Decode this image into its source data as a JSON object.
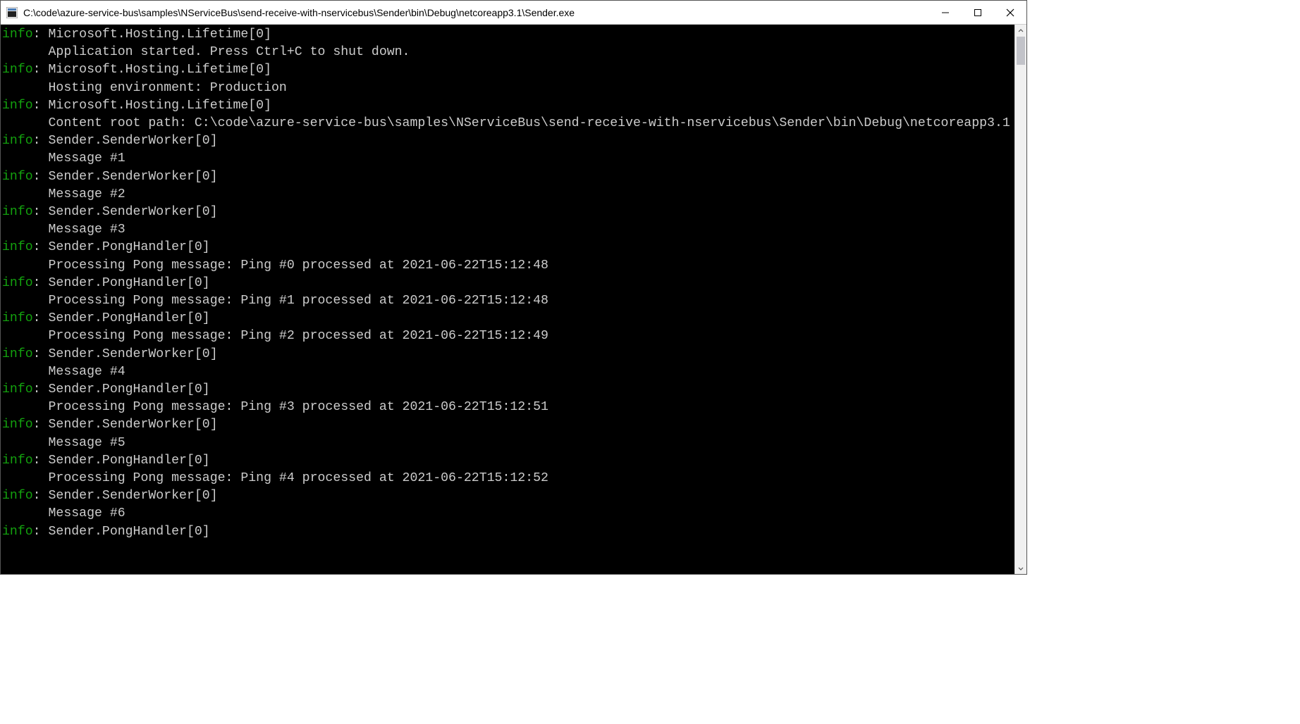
{
  "window": {
    "title": "C:\\code\\azure-service-bus\\samples\\NServiceBus\\send-receive-with-nservicebus\\Sender\\bin\\Debug\\netcoreapp3.1\\Sender.exe"
  },
  "log": {
    "level_label": "info",
    "indent": "      ",
    "entries": [
      {
        "source": "Microsoft.Hosting.Lifetime[0]",
        "body": "Application started. Press Ctrl+C to shut down."
      },
      {
        "source": "Microsoft.Hosting.Lifetime[0]",
        "body": "Hosting environment: Production"
      },
      {
        "source": "Microsoft.Hosting.Lifetime[0]",
        "body": "Content root path: C:\\code\\azure-service-bus\\samples\\NServiceBus\\send-receive-with-nservicebus\\Sender\\bin\\Debug\\netcoreapp3.1"
      },
      {
        "source": "Sender.SenderWorker[0]",
        "body": "Message #1"
      },
      {
        "source": "Sender.SenderWorker[0]",
        "body": "Message #2"
      },
      {
        "source": "Sender.SenderWorker[0]",
        "body": "Message #3"
      },
      {
        "source": "Sender.PongHandler[0]",
        "body": "Processing Pong message: Ping #0 processed at 2021-06-22T15:12:48"
      },
      {
        "source": "Sender.PongHandler[0]",
        "body": "Processing Pong message: Ping #1 processed at 2021-06-22T15:12:48"
      },
      {
        "source": "Sender.PongHandler[0]",
        "body": "Processing Pong message: Ping #2 processed at 2021-06-22T15:12:49"
      },
      {
        "source": "Sender.SenderWorker[0]",
        "body": "Message #4"
      },
      {
        "source": "Sender.PongHandler[0]",
        "body": "Processing Pong message: Ping #3 processed at 2021-06-22T15:12:51"
      },
      {
        "source": "Sender.SenderWorker[0]",
        "body": "Message #5"
      },
      {
        "source": "Sender.PongHandler[0]",
        "body": "Processing Pong message: Ping #4 processed at 2021-06-22T15:12:52"
      },
      {
        "source": "Sender.SenderWorker[0]",
        "body": "Message #6"
      },
      {
        "source": "Sender.PongHandler[0]",
        "body": ""
      }
    ]
  }
}
